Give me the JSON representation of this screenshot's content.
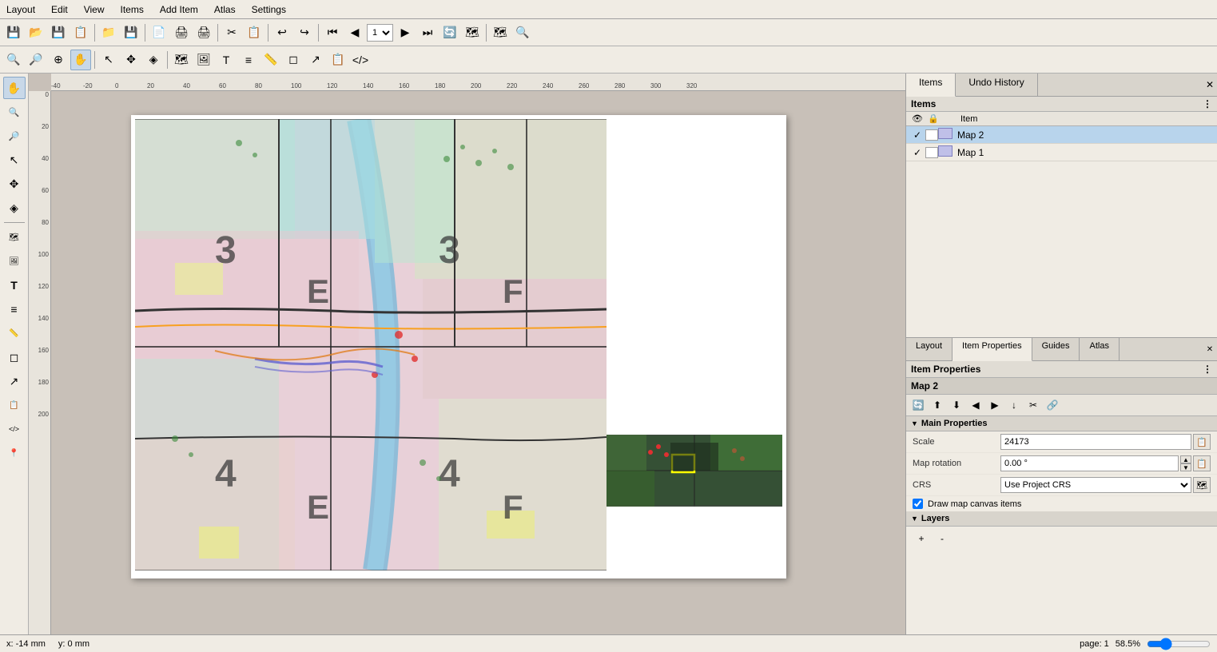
{
  "menubar": {
    "items": [
      "Layout",
      "Edit",
      "View",
      "Items",
      "Add Item",
      "Atlas",
      "Settings"
    ]
  },
  "toolbar1": {
    "buttons": [
      "💾",
      "📂",
      "📋",
      "🔍",
      "📁",
      "💾",
      "📄",
      "🖨",
      "🖨",
      "✂",
      "📋",
      "↩",
      "↪",
      "📄",
      "⏮",
      "◀",
      "▶",
      "⏭",
      "🔄",
      "🗺"
    ]
  },
  "page_select": "1",
  "toolbar2": {
    "buttons": [
      "🔍+",
      "🔍-",
      "🔍",
      "✋",
      "↔",
      "🔄",
      "📍",
      "📐",
      "📏",
      "🔶",
      "📊",
      "📈"
    ]
  },
  "left_toolbar": {
    "buttons": [
      {
        "name": "pan",
        "icon": "✋",
        "active": true
      },
      {
        "name": "zoom-in",
        "icon": "🔍+"
      },
      {
        "name": "zoom-out",
        "icon": "🔍-"
      },
      {
        "name": "select",
        "icon": "↖"
      },
      {
        "name": "move-content",
        "icon": "✋"
      },
      {
        "name": "edit-nodes",
        "icon": "◈"
      },
      {
        "name": "add-map",
        "icon": "🗺"
      },
      {
        "name": "add-picture",
        "icon": "🖼"
      },
      {
        "name": "add-label",
        "icon": "T"
      },
      {
        "name": "add-legend",
        "icon": "≡"
      },
      {
        "name": "add-scalebar",
        "icon": "📏"
      },
      {
        "name": "add-shape",
        "icon": "◻"
      },
      {
        "name": "add-arrow",
        "icon": "↗"
      },
      {
        "name": "add-attribute-table",
        "icon": "📋"
      },
      {
        "name": "add-html",
        "icon": "</>"
      },
      {
        "name": "pin",
        "icon": "📍"
      }
    ]
  },
  "ruler": {
    "top_marks": [
      "-40",
      "-20",
      "0",
      "20",
      "40",
      "60",
      "80",
      "100",
      "120",
      "140",
      "160",
      "180",
      "200",
      "220",
      "240",
      "260",
      "280",
      "300",
      "320"
    ],
    "left_marks": [
      "0",
      "20",
      "40",
      "60",
      "80",
      "100",
      "120",
      "140",
      "160",
      "180",
      "200"
    ]
  },
  "right_panel": {
    "top_tabs": [
      {
        "id": "items",
        "label": "Items",
        "active": true
      },
      {
        "id": "undo-history",
        "label": "Undo History",
        "active": false
      }
    ],
    "items_panel": {
      "title": "Items",
      "columns": [
        "👁",
        "🔒",
        "Item"
      ],
      "rows": [
        {
          "checked": true,
          "locked": false,
          "icon": "map",
          "name": "Map 2",
          "selected": true
        },
        {
          "checked": true,
          "locked": false,
          "icon": "map",
          "name": "Map 1",
          "selected": false
        }
      ]
    },
    "prop_tabs": [
      {
        "id": "layout",
        "label": "Layout",
        "active": false
      },
      {
        "id": "item-properties",
        "label": "Item Properties",
        "active": true
      },
      {
        "id": "guides",
        "label": "Guides",
        "active": false
      },
      {
        "id": "atlas",
        "label": "Atlas",
        "active": false
      }
    ],
    "item_properties": {
      "title": "Item Properties",
      "selected_item": "Map 2",
      "toolbar_buttons": [
        "🔄",
        "📤",
        "📥",
        "◀",
        "▶",
        "⬇",
        "✂",
        "🔗"
      ],
      "sections": {
        "main_properties": {
          "title": "Main Properties",
          "collapsed": false,
          "fields": {
            "scale": {
              "label": "Scale",
              "value": "24173"
            },
            "map_rotation": {
              "label": "Map rotation",
              "value": "0.00 °"
            },
            "crs": {
              "label": "CRS",
              "value": "Use Project CRS"
            },
            "draw_map_canvas": {
              "label": "Draw map canvas items",
              "checked": true
            }
          }
        },
        "layers": {
          "title": "Layers",
          "collapsed": false
        }
      }
    }
  },
  "statusbar": {
    "x": "x: -14 mm",
    "y": "y: 0 mm",
    "page": "page: 1",
    "zoom": "58.5%"
  }
}
